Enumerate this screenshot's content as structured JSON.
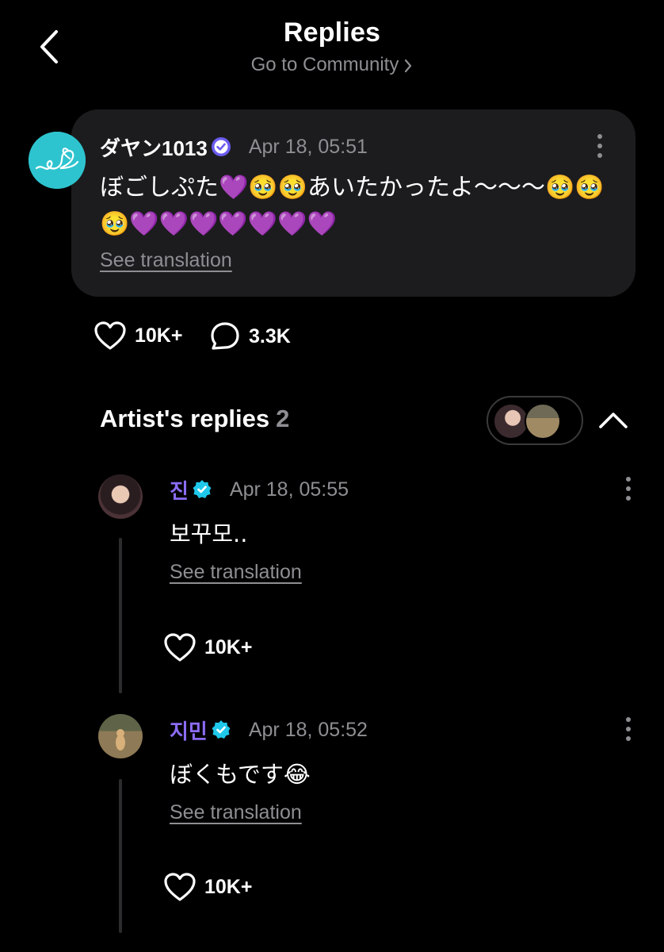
{
  "header": {
    "title": "Replies",
    "subtitle": "Go to Community"
  },
  "post": {
    "author": "ダヤン1013",
    "time": "Apr 18, 05:51",
    "text": "ぼごしぷた💜🥹🥹あいたかったよ〜〜〜🥹🥹🥹💜💜💜💜💜💜💜",
    "see_translation": "See translation",
    "likes": "10K+",
    "comments": "3.3K"
  },
  "artist_replies": {
    "title": "Artist's replies",
    "count": "2"
  },
  "replies": [
    {
      "author": "진",
      "time": "Apr 18, 05:55",
      "text": "보꾸모..",
      "see_translation": "See translation",
      "likes": "10K+"
    },
    {
      "author": "지민",
      "time": "Apr 18, 05:52",
      "text": "ぼくもです😂",
      "see_translation": "See translation",
      "likes": "10K+"
    }
  ],
  "colors": {
    "background": "#000000",
    "card": "#1c1c1e",
    "artist_name": "#8b6cf5",
    "verified_badge": "#1fc8ea",
    "muted_text": "#8e8e93"
  },
  "icons": {
    "back": "chevron-left-icon",
    "more": "more-vertical-icon",
    "like": "heart-outline-icon",
    "comment": "chat-bubble-icon",
    "collapse": "chevron-up-icon"
  }
}
